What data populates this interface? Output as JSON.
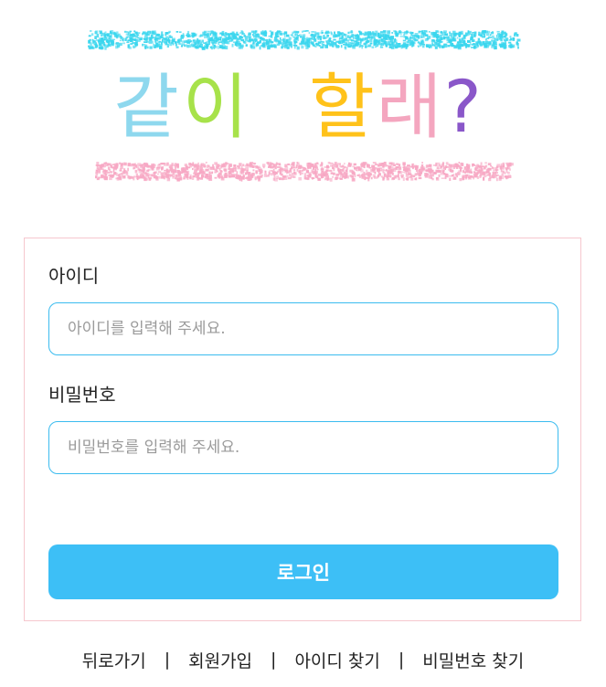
{
  "logo": {
    "text_part1": "같이",
    "text_part2": "할래?",
    "colors": {
      "top_stripe": "#3ad6ee",
      "bottom_stripe": "#f7a8c4",
      "gat": "#8ed8ee",
      "i": "#a7e24a",
      "hal": "#ffc21a",
      "rae": "#f4a6bf",
      "question": "#8a57c9"
    }
  },
  "form": {
    "id_label": "아이디",
    "id_placeholder": "아이디를 입력해 주세요.",
    "id_value": "",
    "password_label": "비밀번호",
    "password_placeholder": "비밀번호를 입력해 주세요.",
    "password_value": "",
    "login_button": "로그인"
  },
  "links": {
    "back": "뒤로가기",
    "signup": "회원가입",
    "find_id": "아이디 찾기",
    "find_password": "비밀번호 찾기",
    "separator": "|"
  },
  "colors": {
    "accent": "#3dbff6",
    "input_border": "#3bbcef",
    "card_border": "#f6c7ce"
  }
}
